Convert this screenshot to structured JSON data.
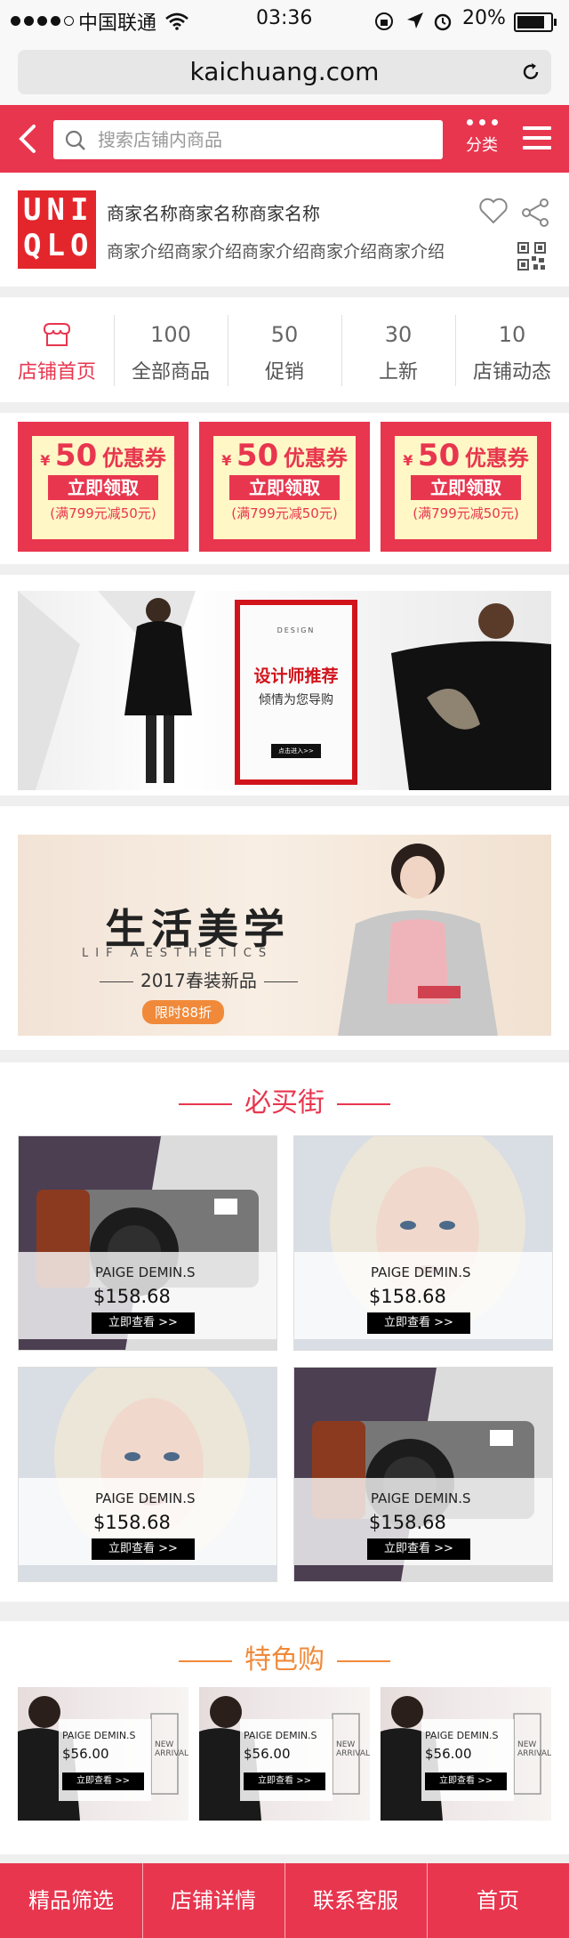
{
  "status_bar": {
    "carrier": "中国联通",
    "time": "03:36",
    "battery": "20%",
    "battery_level": 0.2
  },
  "browser": {
    "url": "kaichuang.com"
  },
  "header": {
    "search_placeholder": "搜索店铺内商品",
    "category_label": "分类"
  },
  "shop": {
    "logo_lines": [
      "UNI",
      "QLO"
    ],
    "name": "商家名称商家名称商家名称",
    "description": "商家介绍商家介绍商家介绍商家介绍商家介绍"
  },
  "tabs": [
    {
      "count": "",
      "label": "店铺首页",
      "active": true
    },
    {
      "count": "100",
      "label": "全部商品"
    },
    {
      "count": "50",
      "label": "促销"
    },
    {
      "count": "30",
      "label": "上新"
    },
    {
      "count": "10",
      "label": "店铺动态"
    }
  ],
  "coupons": [
    {
      "currency": "¥",
      "amount": "50",
      "text": "优惠券",
      "button": "立即领取",
      "condition": "(满799元减50元)"
    },
    {
      "currency": "¥",
      "amount": "50",
      "text": "优惠券",
      "button": "立即领取",
      "condition": "(满799元减50元)"
    },
    {
      "currency": "¥",
      "amount": "50",
      "text": "优惠券",
      "button": "立即领取",
      "condition": "(满799元减50元)"
    }
  ],
  "banner1": {
    "small": "DESIGN",
    "title": "设计师推荐",
    "subtitle": "倾情为您导购",
    "button": "点击进入>>"
  },
  "banner2": {
    "title": "生活美学",
    "english": "LIF AESTHETICS",
    "season": "2017春装新品",
    "button": "限时88折"
  },
  "must_buy": {
    "title": "必买街",
    "products": [
      {
        "name": "PAIGE DEMIN.S",
        "price": "$158.68",
        "button": "立即查看 >>",
        "image": "camera"
      },
      {
        "name": "PAIGE DEMIN.S",
        "price": "$158.68",
        "button": "立即查看 >>",
        "image": "portrait"
      },
      {
        "name": "PAIGE DEMIN.S",
        "price": "$158.68",
        "button": "立即查看 >>",
        "image": "portrait"
      },
      {
        "name": "PAIGE DEMIN.S",
        "price": "$158.68",
        "button": "立即查看 >>",
        "image": "camera"
      }
    ]
  },
  "featured": {
    "title": "特色购",
    "products": [
      {
        "name": "PAIGE DEMIN.S",
        "price": "$56.00",
        "button": "立即查看 >>",
        "tag": "NEW ARRIVAL"
      },
      {
        "name": "PAIGE DEMIN.S",
        "price": "$56.00",
        "button": "立即查看 >>",
        "tag": "NEW ARRIVAL"
      },
      {
        "name": "PAIGE DEMIN.S",
        "price": "$56.00",
        "button": "立即查看 >>",
        "tag": "NEW ARRIVAL"
      }
    ]
  },
  "bottom_nav": [
    "精品筛选",
    "店铺详情",
    "联系客服",
    "首页"
  ],
  "colors": {
    "accent": "#e8364f",
    "orange": "#f08a3a",
    "logo_red": "#e3262c"
  }
}
